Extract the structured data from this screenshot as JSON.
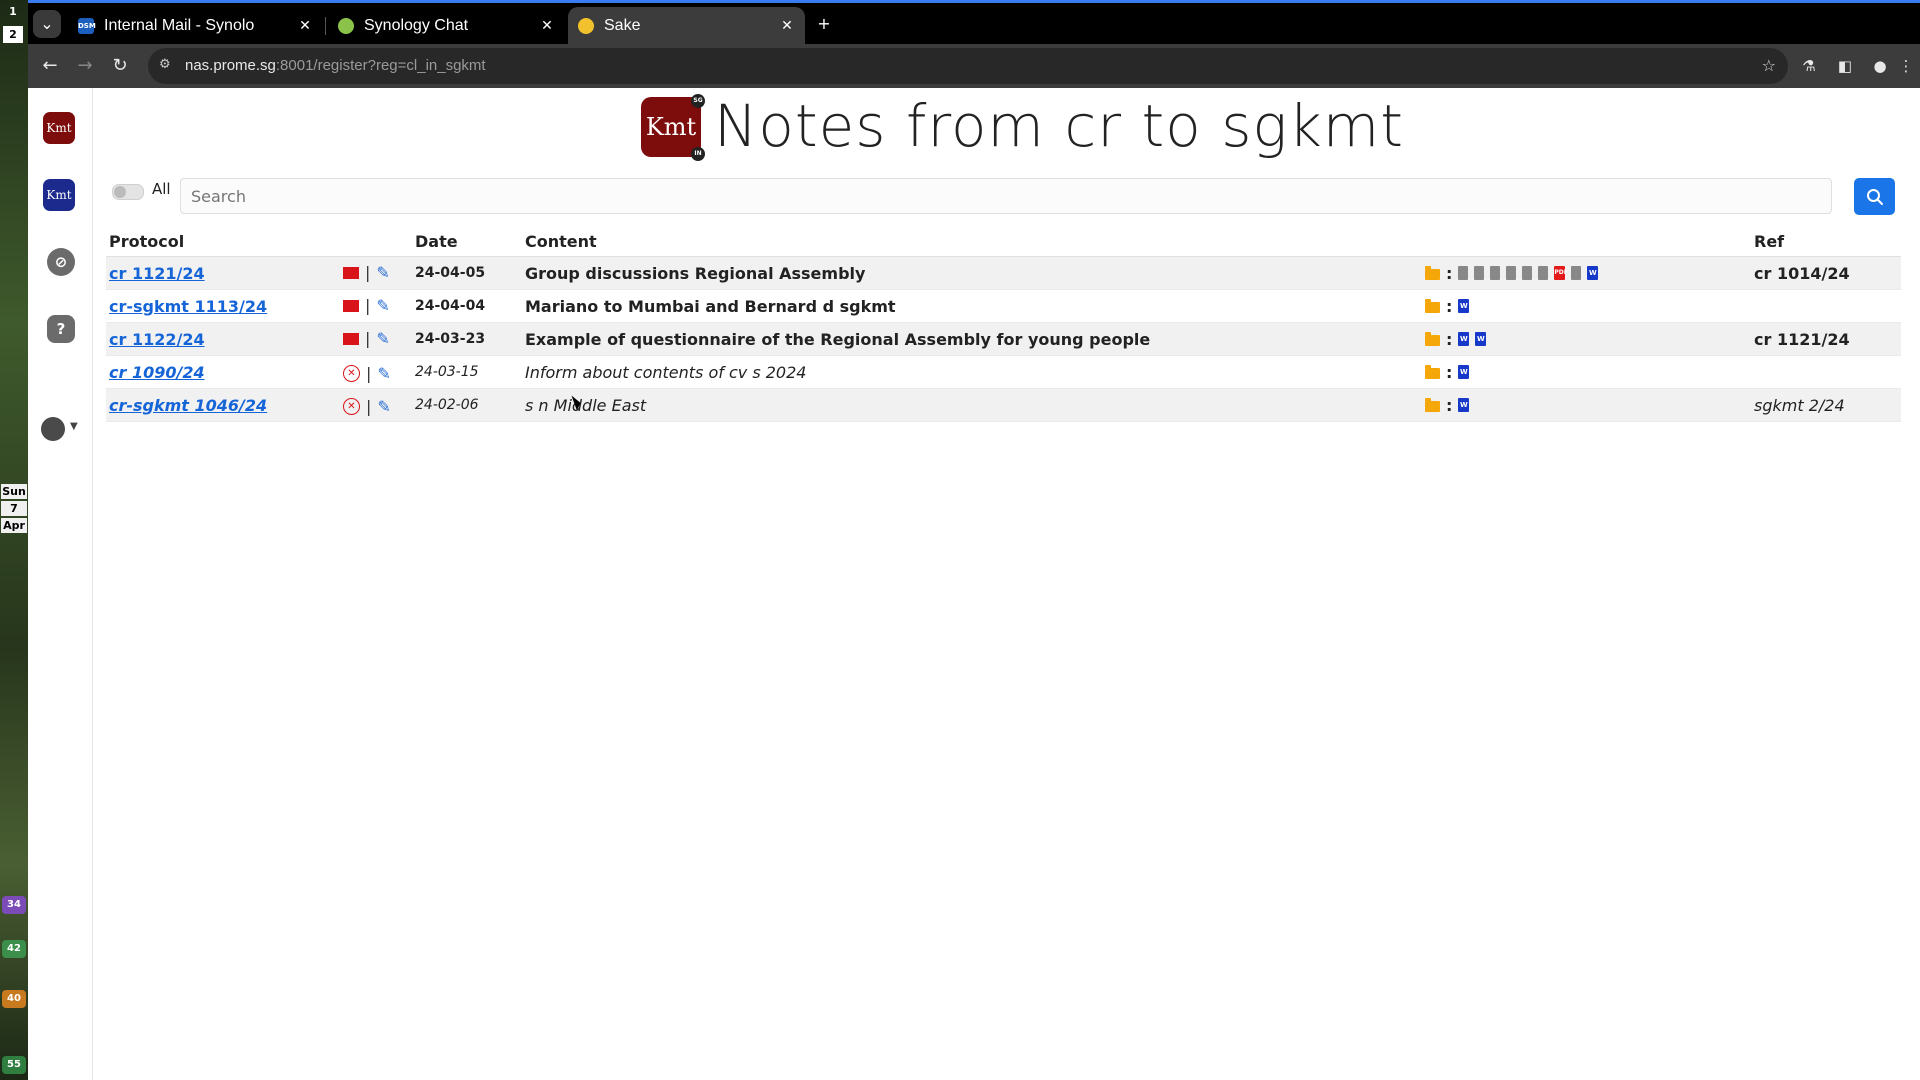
{
  "os_strip": {
    "workspaces": [
      "1",
      "2"
    ],
    "date": {
      "weekday": "Sun",
      "day": "7",
      "month": "Apr"
    },
    "indicators": [
      "34",
      "42",
      "40",
      "55"
    ]
  },
  "browser": {
    "tabs": [
      {
        "title": "Internal Mail - Synolo",
        "favicon": "DSM"
      },
      {
        "title": "Synology Chat",
        "favicon": ""
      },
      {
        "title": "Sake",
        "favicon": ""
      }
    ],
    "address": {
      "host": "nas.prome.sg",
      "rest": ":8001/register?reg=cl_in_sgkmt"
    }
  },
  "sidebar": {
    "logo_red_text": "Kmt",
    "logo_blue_text": "Kmt",
    "help_label": "?"
  },
  "header": {
    "logo_text": "Kmt",
    "badge_top": "SG",
    "badge_bottom": "IN",
    "title": "Notes from cr to sgkmt"
  },
  "filter": {
    "toggle_label": "All",
    "search_placeholder": "Search"
  },
  "table": {
    "columns": [
      "Protocol",
      "Date",
      "Content",
      "Ref"
    ],
    "rows": [
      {
        "protocol": "cr 1121/24",
        "date": "24-04-05",
        "content": "Group discussions Regional Assembly",
        "ref": "cr 1014/24",
        "status": "mail",
        "attachments": [
          "doc",
          "doc",
          "doc",
          "doc",
          "doc",
          "doc",
          "pdf",
          "doc",
          "word"
        ]
      },
      {
        "protocol": "cr-sgkmt 1113/24",
        "date": "24-04-04",
        "content": "Mariano to Mumbai and Bernard d sgkmt",
        "ref": "",
        "status": "mail",
        "attachments": [
          "word"
        ]
      },
      {
        "protocol": "cr 1122/24",
        "date": "24-03-23",
        "content": "Example of questionnaire of the Regional Assembly for young people",
        "ref": "cr 1121/24",
        "status": "mail",
        "attachments": [
          "word",
          "word"
        ]
      },
      {
        "protocol": "cr 1090/24",
        "date": "24-03-15",
        "content": "Inform about contents of cv s 2024",
        "ref": "",
        "status": "not-sent",
        "attachments": [
          "word"
        ]
      },
      {
        "protocol": "cr-sgkmt 1046/24",
        "date": "24-02-06",
        "content": "s n Middle East",
        "ref": "sgkmt 2/24",
        "status": "not-sent",
        "attachments": [
          "word"
        ]
      }
    ]
  },
  "colors": {
    "brand_red": "#7d0c0c",
    "brand_blue": "#1b2a8c",
    "link_blue": "#1565d8",
    "search_button": "#1a75e8",
    "mail_red": "#d8141a",
    "folder": "#f5a70a"
  },
  "icons": [
    "search-icon",
    "mail-icon",
    "pencil-icon",
    "cancel-circle-icon",
    "folder-icon",
    "document-icon",
    "word-icon",
    "pdf-icon"
  ]
}
